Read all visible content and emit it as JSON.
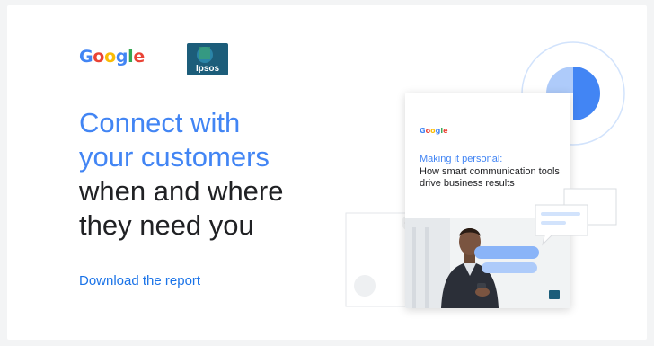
{
  "brand": {
    "google": "Google",
    "ipsos": "Ipsos"
  },
  "headline": {
    "line1": "Connect with",
    "line2": "your customers",
    "line3": "when and where",
    "line4": "they need you"
  },
  "cta": {
    "label": "Download the report"
  },
  "report": {
    "logo": "Google",
    "title_line1": "Making it personal:",
    "title_line2": "How smart communication tools drive business results"
  },
  "colors": {
    "blue": "#4285f4",
    "dark": "#202124",
    "link": "#1a73e8",
    "ipsos": "#1c5d7a"
  }
}
